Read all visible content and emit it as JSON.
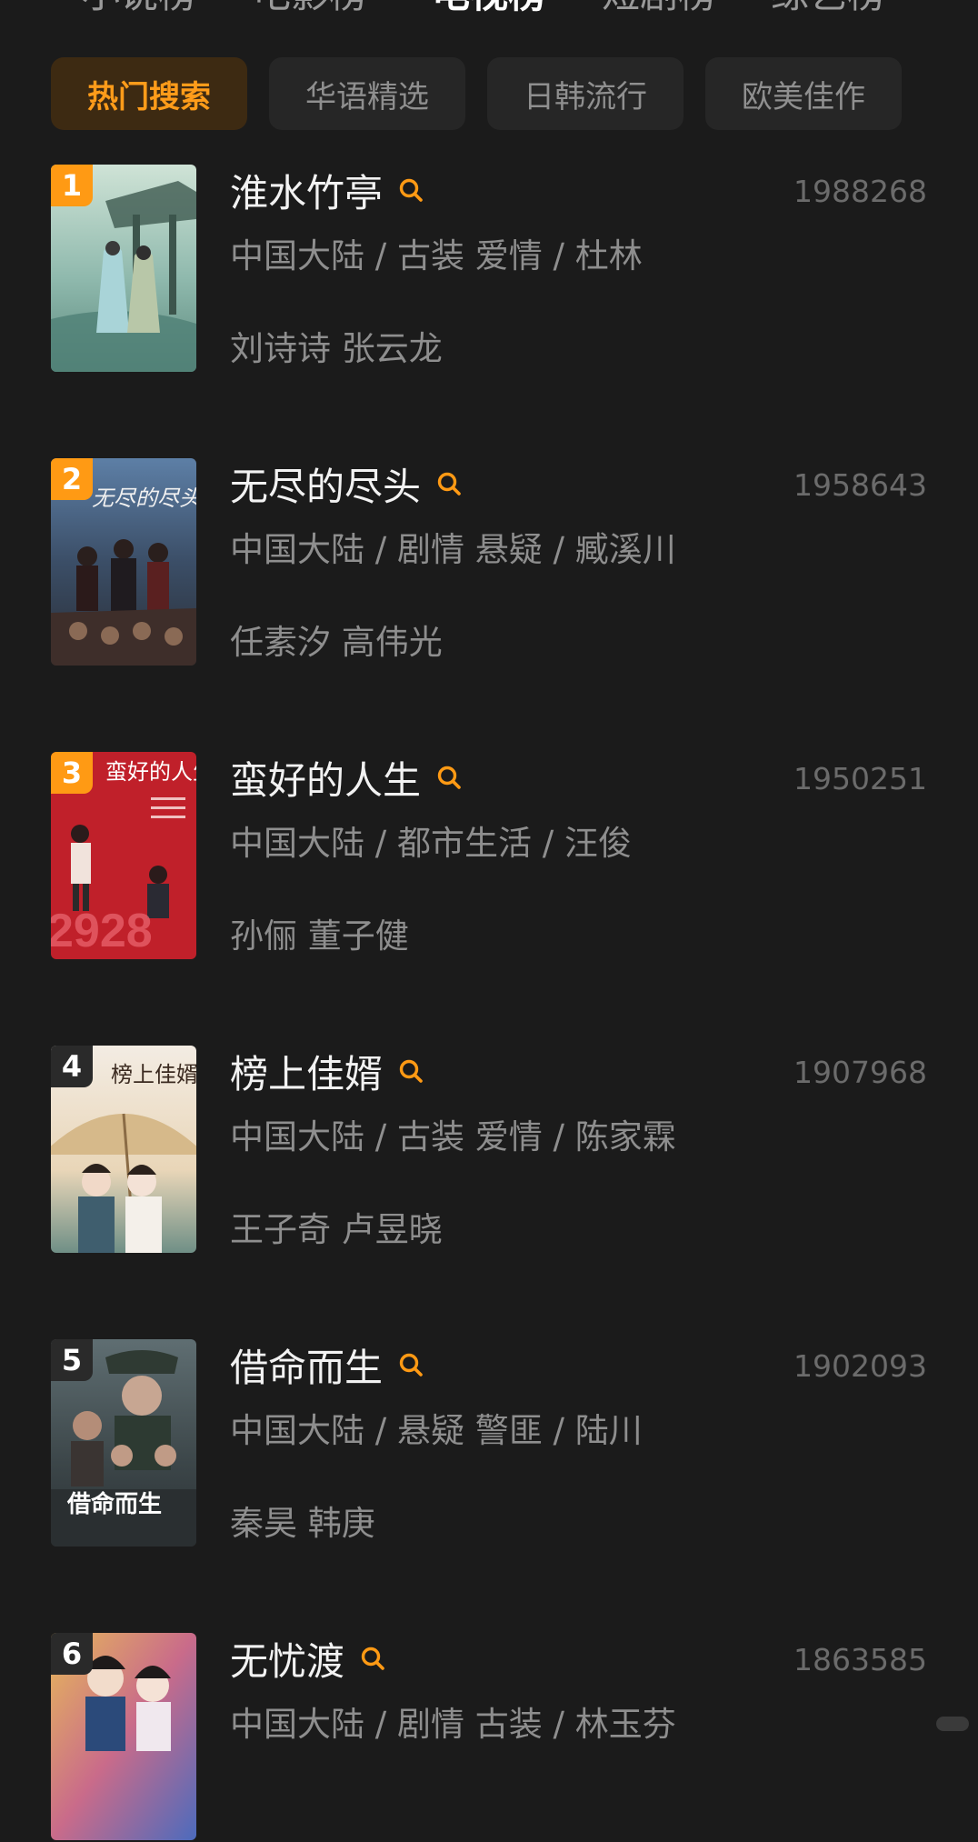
{
  "top_tabs": [
    {
      "label": "小说榜"
    },
    {
      "label": "电影榜"
    },
    {
      "label": "电视榜"
    },
    {
      "label": "短剧榜"
    },
    {
      "label": "综艺榜"
    }
  ],
  "active_top_tab": "电视榜",
  "filter_chips": [
    {
      "label": "热门搜索",
      "active": true
    },
    {
      "label": "华语精选",
      "active": false
    },
    {
      "label": "日韩流行",
      "active": false
    },
    {
      "label": "欧美佳作",
      "active": false
    }
  ],
  "items": [
    {
      "rank": "1",
      "title": "淮水竹亭",
      "meta": "中国大陆 / 古装 爱情 / 杜林",
      "cast": "刘诗诗 张云龙",
      "heat": "1988268"
    },
    {
      "rank": "2",
      "title": "无尽的尽头",
      "meta": "中国大陆 / 剧情 悬疑 / 臧溪川",
      "cast": "任素汐 高伟光",
      "heat": "1958643"
    },
    {
      "rank": "3",
      "title": "蛮好的人生",
      "meta": "中国大陆 / 都市生活 / 汪俊",
      "cast": "孙俪 董子健",
      "heat": "1950251"
    },
    {
      "rank": "4",
      "title": "榜上佳婿",
      "meta": "中国大陆 / 古装 爱情 / 陈家霖",
      "cast": "王子奇 卢昱晓",
      "heat": "1907968"
    },
    {
      "rank": "5",
      "title": "借命而生",
      "meta": "中国大陆 / 悬疑 警匪 / 陆川",
      "cast": "秦昊 韩庚",
      "heat": "1902093"
    },
    {
      "rank": "6",
      "title": "无忧渡",
      "meta": "中国大陆 / 剧情 古装 / 林玉芬",
      "cast": "",
      "heat": "1863585"
    }
  ],
  "poster_text": {
    "p2": "无尽的尽头",
    "p3": "蛮好的人生",
    "p4": "榜上佳婿",
    "p5": "借命而生"
  },
  "colors": {
    "accent": "#ff9a14",
    "background": "#1b1b1b"
  }
}
